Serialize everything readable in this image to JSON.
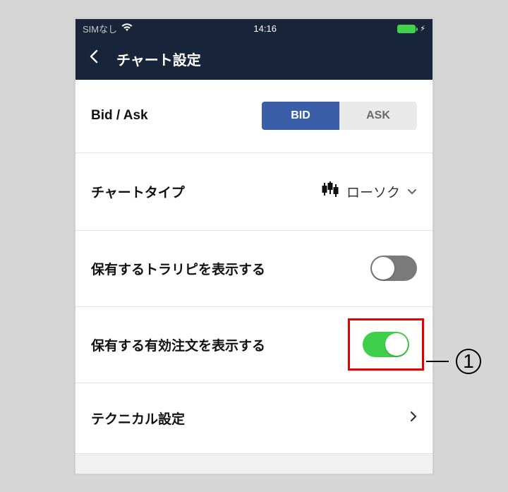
{
  "statusbar": {
    "carrier": "SIMなし",
    "time": "14:16"
  },
  "navbar": {
    "title": "チャート設定"
  },
  "rows": {
    "bidask": {
      "label": "Bid / Ask",
      "bid": "BID",
      "ask": "ASK",
      "selected": "BID"
    },
    "chart_type": {
      "label": "チャートタイプ",
      "value": "ローソク"
    },
    "toraripi": {
      "label": "保有するトラリピを表示する",
      "on": false
    },
    "orders": {
      "label": "保有する有効注文を表示する",
      "on": true
    },
    "technical": {
      "label": "テクニカル設定"
    }
  },
  "callout": {
    "label": "1"
  }
}
